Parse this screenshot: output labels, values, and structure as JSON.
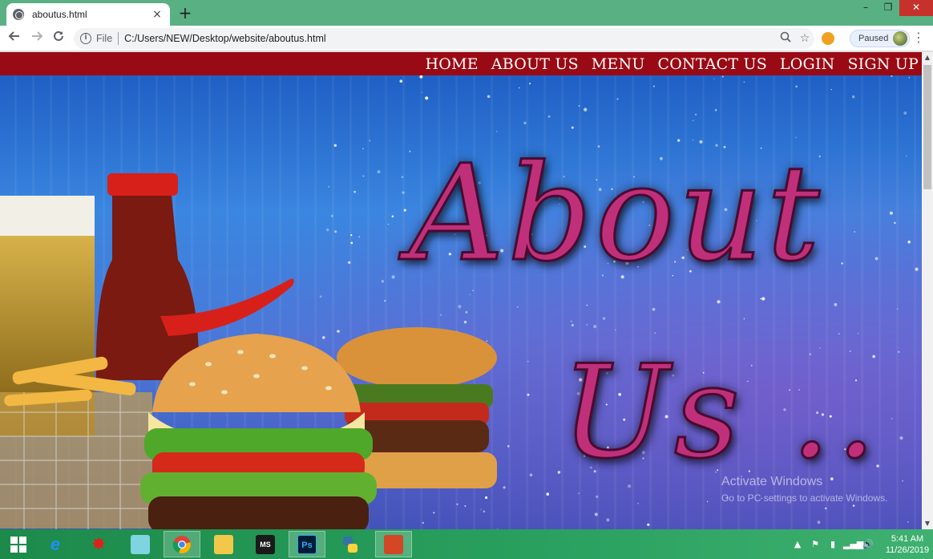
{
  "browser": {
    "tab_title": "aboutus.html",
    "tab_close": "×",
    "new_tab": "+",
    "url_scheme": "File",
    "url": "C:/Users/NEW/Desktop/website/aboutus.html",
    "profile_status": "Paused",
    "window_controls": {
      "minimize": "–",
      "restore": "❐",
      "close": "✕"
    }
  },
  "site_nav": {
    "items": [
      "HOME",
      "ABOUT US",
      "MENU",
      "CONTACT US",
      "LOGIN",
      "SIGN UP"
    ]
  },
  "hero": {
    "title_line1": "About",
    "title_line2": "Us .."
  },
  "watermark": {
    "line1": "Activate Windows",
    "line2": "Go to PC settings to activate Windows."
  },
  "taskbar": {
    "apps": [
      "start-button",
      "internet-explorer",
      "app-red",
      "app-notes",
      "chrome",
      "file-explorer",
      "ms-project",
      "photoshop",
      "python",
      "powerpoint"
    ],
    "ps_label": "Ps",
    "time": "5:41 AM",
    "date": "11/26/2019"
  },
  "colors": {
    "nav_bar": "#9a0a14",
    "title_text": "#c0307a",
    "taskbar": "#2aa160"
  }
}
